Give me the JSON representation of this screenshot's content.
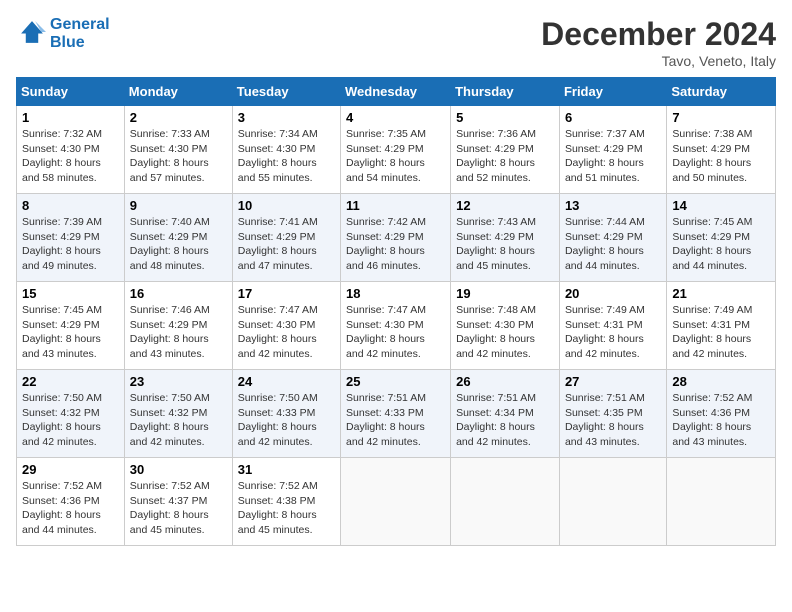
{
  "header": {
    "logo_line1": "General",
    "logo_line2": "Blue",
    "month_title": "December 2024",
    "subtitle": "Tavo, Veneto, Italy"
  },
  "weekdays": [
    "Sunday",
    "Monday",
    "Tuesday",
    "Wednesday",
    "Thursday",
    "Friday",
    "Saturday"
  ],
  "weeks": [
    [
      {
        "day": "1",
        "sunrise": "Sunrise: 7:32 AM",
        "sunset": "Sunset: 4:30 PM",
        "daylight": "Daylight: 8 hours and 58 minutes."
      },
      {
        "day": "2",
        "sunrise": "Sunrise: 7:33 AM",
        "sunset": "Sunset: 4:30 PM",
        "daylight": "Daylight: 8 hours and 57 minutes."
      },
      {
        "day": "3",
        "sunrise": "Sunrise: 7:34 AM",
        "sunset": "Sunset: 4:30 PM",
        "daylight": "Daylight: 8 hours and 55 minutes."
      },
      {
        "day": "4",
        "sunrise": "Sunrise: 7:35 AM",
        "sunset": "Sunset: 4:29 PM",
        "daylight": "Daylight: 8 hours and 54 minutes."
      },
      {
        "day": "5",
        "sunrise": "Sunrise: 7:36 AM",
        "sunset": "Sunset: 4:29 PM",
        "daylight": "Daylight: 8 hours and 52 minutes."
      },
      {
        "day": "6",
        "sunrise": "Sunrise: 7:37 AM",
        "sunset": "Sunset: 4:29 PM",
        "daylight": "Daylight: 8 hours and 51 minutes."
      },
      {
        "day": "7",
        "sunrise": "Sunrise: 7:38 AM",
        "sunset": "Sunset: 4:29 PM",
        "daylight": "Daylight: 8 hours and 50 minutes."
      }
    ],
    [
      {
        "day": "8",
        "sunrise": "Sunrise: 7:39 AM",
        "sunset": "Sunset: 4:29 PM",
        "daylight": "Daylight: 8 hours and 49 minutes."
      },
      {
        "day": "9",
        "sunrise": "Sunrise: 7:40 AM",
        "sunset": "Sunset: 4:29 PM",
        "daylight": "Daylight: 8 hours and 48 minutes."
      },
      {
        "day": "10",
        "sunrise": "Sunrise: 7:41 AM",
        "sunset": "Sunset: 4:29 PM",
        "daylight": "Daylight: 8 hours and 47 minutes."
      },
      {
        "day": "11",
        "sunrise": "Sunrise: 7:42 AM",
        "sunset": "Sunset: 4:29 PM",
        "daylight": "Daylight: 8 hours and 46 minutes."
      },
      {
        "day": "12",
        "sunrise": "Sunrise: 7:43 AM",
        "sunset": "Sunset: 4:29 PM",
        "daylight": "Daylight: 8 hours and 45 minutes."
      },
      {
        "day": "13",
        "sunrise": "Sunrise: 7:44 AM",
        "sunset": "Sunset: 4:29 PM",
        "daylight": "Daylight: 8 hours and 44 minutes."
      },
      {
        "day": "14",
        "sunrise": "Sunrise: 7:45 AM",
        "sunset": "Sunset: 4:29 PM",
        "daylight": "Daylight: 8 hours and 44 minutes."
      }
    ],
    [
      {
        "day": "15",
        "sunrise": "Sunrise: 7:45 AM",
        "sunset": "Sunset: 4:29 PM",
        "daylight": "Daylight: 8 hours and 43 minutes."
      },
      {
        "day": "16",
        "sunrise": "Sunrise: 7:46 AM",
        "sunset": "Sunset: 4:29 PM",
        "daylight": "Daylight: 8 hours and 43 minutes."
      },
      {
        "day": "17",
        "sunrise": "Sunrise: 7:47 AM",
        "sunset": "Sunset: 4:30 PM",
        "daylight": "Daylight: 8 hours and 42 minutes."
      },
      {
        "day": "18",
        "sunrise": "Sunrise: 7:47 AM",
        "sunset": "Sunset: 4:30 PM",
        "daylight": "Daylight: 8 hours and 42 minutes."
      },
      {
        "day": "19",
        "sunrise": "Sunrise: 7:48 AM",
        "sunset": "Sunset: 4:30 PM",
        "daylight": "Daylight: 8 hours and 42 minutes."
      },
      {
        "day": "20",
        "sunrise": "Sunrise: 7:49 AM",
        "sunset": "Sunset: 4:31 PM",
        "daylight": "Daylight: 8 hours and 42 minutes."
      },
      {
        "day": "21",
        "sunrise": "Sunrise: 7:49 AM",
        "sunset": "Sunset: 4:31 PM",
        "daylight": "Daylight: 8 hours and 42 minutes."
      }
    ],
    [
      {
        "day": "22",
        "sunrise": "Sunrise: 7:50 AM",
        "sunset": "Sunset: 4:32 PM",
        "daylight": "Daylight: 8 hours and 42 minutes."
      },
      {
        "day": "23",
        "sunrise": "Sunrise: 7:50 AM",
        "sunset": "Sunset: 4:32 PM",
        "daylight": "Daylight: 8 hours and 42 minutes."
      },
      {
        "day": "24",
        "sunrise": "Sunrise: 7:50 AM",
        "sunset": "Sunset: 4:33 PM",
        "daylight": "Daylight: 8 hours and 42 minutes."
      },
      {
        "day": "25",
        "sunrise": "Sunrise: 7:51 AM",
        "sunset": "Sunset: 4:33 PM",
        "daylight": "Daylight: 8 hours and 42 minutes."
      },
      {
        "day": "26",
        "sunrise": "Sunrise: 7:51 AM",
        "sunset": "Sunset: 4:34 PM",
        "daylight": "Daylight: 8 hours and 42 minutes."
      },
      {
        "day": "27",
        "sunrise": "Sunrise: 7:51 AM",
        "sunset": "Sunset: 4:35 PM",
        "daylight": "Daylight: 8 hours and 43 minutes."
      },
      {
        "day": "28",
        "sunrise": "Sunrise: 7:52 AM",
        "sunset": "Sunset: 4:36 PM",
        "daylight": "Daylight: 8 hours and 43 minutes."
      }
    ],
    [
      {
        "day": "29",
        "sunrise": "Sunrise: 7:52 AM",
        "sunset": "Sunset: 4:36 PM",
        "daylight": "Daylight: 8 hours and 44 minutes."
      },
      {
        "day": "30",
        "sunrise": "Sunrise: 7:52 AM",
        "sunset": "Sunset: 4:37 PM",
        "daylight": "Daylight: 8 hours and 45 minutes."
      },
      {
        "day": "31",
        "sunrise": "Sunrise: 7:52 AM",
        "sunset": "Sunset: 4:38 PM",
        "daylight": "Daylight: 8 hours and 45 minutes."
      },
      null,
      null,
      null,
      null
    ]
  ]
}
